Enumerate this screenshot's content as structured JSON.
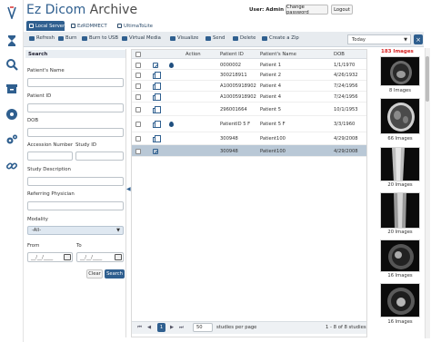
{
  "app": {
    "title_bold": "Ez Dicom",
    "title_light": "Archive",
    "user_label": "User: Admin",
    "change_password": "Change password",
    "logout": "Logout"
  },
  "tabs": [
    {
      "label": "Local Server",
      "active": true
    },
    {
      "label": "EzRDMMECT",
      "active": false
    },
    {
      "label": "UltimaToLite",
      "active": false
    }
  ],
  "toolbar": {
    "items": [
      "Refresh",
      "Burn",
      "Burn to USB",
      "Virtual Media",
      "Visualize",
      "Send",
      "Delete",
      "Create a Zip"
    ],
    "date_filter": "Today"
  },
  "search": {
    "title": "Search",
    "patient_name_label": "Patient's Name",
    "patient_id_label": "Patient ID",
    "dob_label": "DOB",
    "accession_label": "Accession Number",
    "study_id_label": "Study ID",
    "study_description_label": "Study Description",
    "referring_physician_label": "Referring Physician",
    "modality_label": "Modality",
    "modality_value": "-All-",
    "from_label": "From",
    "to_label": "To",
    "date_placeholder": "__/__/____",
    "clear": "Clear",
    "search": "Search"
  },
  "grid": {
    "headers": [
      "Action",
      "Patient ID",
      "Patient's Name",
      "DOB"
    ],
    "rows": [
      {
        "patient_id": "0000002",
        "name": "Patient 1",
        "dob": "1/1/1970",
        "icons": [
          "edit",
          "drop"
        ]
      },
      {
        "patient_id": "300218911",
        "name": "Patient 2",
        "dob": "4/26/1932",
        "icons": [
          "copy"
        ]
      },
      {
        "patient_id": "A10005918902",
        "name": "Patient 4",
        "dob": "7/24/1956",
        "icons": [
          "copy"
        ]
      },
      {
        "patient_id": "A10005918902",
        "name": "Patient 4",
        "dob": "7/24/1956",
        "icons": [
          "copy"
        ]
      },
      {
        "patient_id": "296001664",
        "name": "Patient 5",
        "dob": "10/1/1953",
        "icons": [
          "copy"
        ]
      },
      {
        "patient_id": "PatientID 5 F",
        "name": "Patient 5 F",
        "dob": "3/3/1960",
        "icons": [
          "copy",
          "drop"
        ]
      },
      {
        "patient_id": "300948",
        "name": "Patient100",
        "dob": "4/29/2008",
        "icons": [
          "copy"
        ]
      },
      {
        "patient_id": "300948",
        "name": "Patient100",
        "dob": "4/29/2008",
        "icons": [
          "edit"
        ],
        "selected": true
      }
    ],
    "pager": {
      "first": "⏮",
      "prev": "◀",
      "current_page": "1",
      "next": "▶",
      "last": "⏭",
      "per_page": "50",
      "per_page_label": "studies per page",
      "summary": "1 - 8 of 8 studies"
    }
  },
  "thumbnails": {
    "count_label": "183 Images",
    "items": [
      {
        "label": "8 Images"
      },
      {
        "label": "66 Images"
      },
      {
        "label": "20 Images"
      },
      {
        "label": "20 Images"
      },
      {
        "label": "16 Images"
      },
      {
        "label": "16 Images"
      }
    ]
  },
  "colors": {
    "accent": "#2f5f8f",
    "selected_row": "#b9c8d6",
    "image_count": "#d62020"
  },
  "icons": {
    "rail": [
      "hourglass-icon",
      "search-icon",
      "archive-box-icon",
      "disc-icon",
      "gears-icon",
      "link-icon"
    ]
  }
}
